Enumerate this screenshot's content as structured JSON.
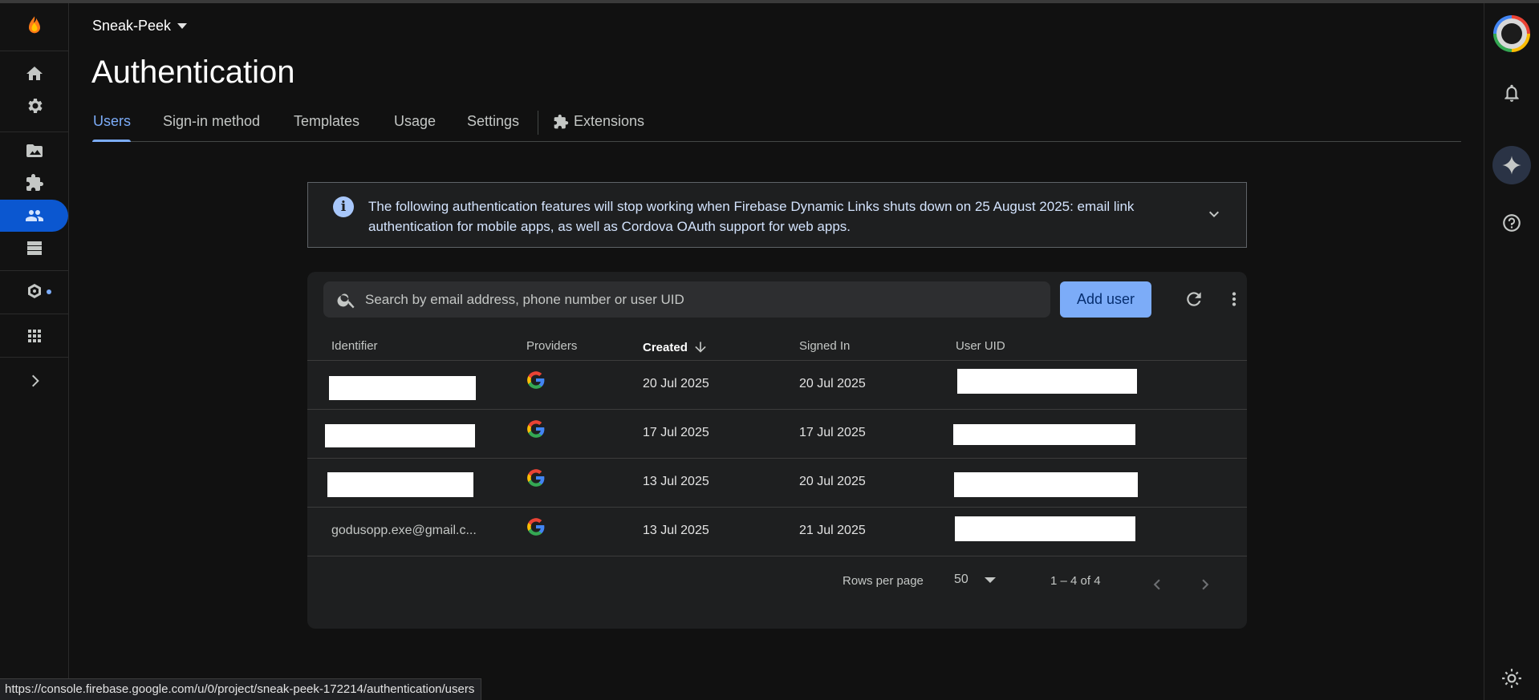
{
  "header": {
    "project_name": "Sneak-Peek",
    "page_title": "Authentication"
  },
  "tabs": [
    {
      "label": "Users",
      "active": true
    },
    {
      "label": "Sign-in method"
    },
    {
      "label": "Templates"
    },
    {
      "label": "Usage"
    },
    {
      "label": "Settings"
    },
    {
      "label": "Extensions"
    }
  ],
  "banner": {
    "text": "The following authentication features will stop working when Firebase Dynamic Links shuts down on 25 August 2025: email link authentication for mobile apps, as well as Cordova OAuth support for web apps."
  },
  "users": {
    "search_placeholder": "Search by email address, phone number or user UID",
    "add_user_label": "Add user",
    "columns": {
      "identifier": "Identifier",
      "providers": "Providers",
      "created": "Created",
      "signed_in": "Signed In",
      "user_uid": "User UID"
    },
    "rows": [
      {
        "identifier": "",
        "provider": "google-icon",
        "created": "20 Jul 2025",
        "signed_in": "20 Jul 2025",
        "user_uid": ""
      },
      {
        "identifier": "",
        "provider": "google-icon",
        "created": "17 Jul 2025",
        "signed_in": "17 Jul 2025",
        "user_uid": ""
      },
      {
        "identifier": "",
        "provider": "google-icon",
        "created": "13 Jul 2025",
        "signed_in": "20 Jul 2025",
        "user_uid": ""
      },
      {
        "identifier": "godusopp.exe@gmail.c...",
        "provider": "google-icon",
        "created": "13 Jul 2025",
        "signed_in": "21 Jul 2025",
        "user_uid": ""
      }
    ],
    "pagination": {
      "rows_per_page_label": "Rows per page",
      "rows_per_page_value": "50",
      "range": "1 – 4 of 4"
    }
  },
  "statusbar": {
    "url": "https://console.firebase.google.com/u/0/project/sneak-peek-172214/authentication/users"
  },
  "colors": {
    "accent": "#7cacf8",
    "active_nav": "#0b57d0",
    "background": "#111111",
    "card": "#1e1f20"
  }
}
